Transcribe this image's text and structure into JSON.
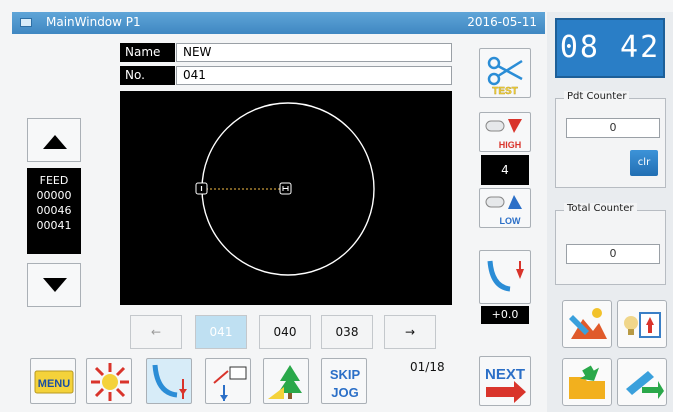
{
  "window": {
    "title": "MainWindow P1",
    "date": "2016-05-11"
  },
  "clock": {
    "time": "08 42"
  },
  "pattern": {
    "name_label": "Name",
    "name_value": "NEW",
    "no_label": "No.",
    "no_value": "041"
  },
  "feed": {
    "label": "FEED",
    "lines": [
      "00000",
      "00046",
      "00041"
    ]
  },
  "right_controls": {
    "test_label": "TEST",
    "high_label": "HIGH",
    "speed_value": "4",
    "low_label": "LOW",
    "offset_value": "+0.0",
    "next_label": "NEXT"
  },
  "counters": {
    "pdt_label": "Pdt Counter",
    "pdt_value": "0",
    "clr_label": "clr",
    "total_label": "Total Counter",
    "total_value": "0"
  },
  "page_nav": {
    "prev": "←",
    "items": [
      "041",
      "040",
      "038"
    ],
    "next": "→",
    "indicator": "01/18"
  },
  "toolbar": {
    "menu_label": "MENU",
    "skip_label": "SKIP",
    "jog_label": "JOG"
  },
  "colors": {
    "accent": "#2a7ec6",
    "titlebar": "#4a93cc",
    "canvas": "#000000",
    "current_page": "#bfe0f2"
  }
}
